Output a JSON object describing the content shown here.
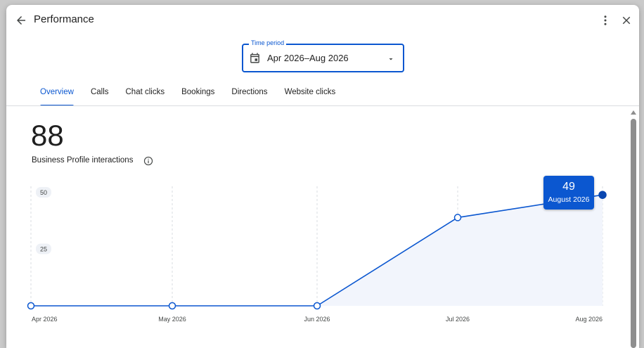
{
  "header": {
    "title": "Performance"
  },
  "time_period": {
    "label": "Time period",
    "value": "Apr 2026–Aug 2026"
  },
  "tabs": [
    {
      "label": "Overview",
      "active": true
    },
    {
      "label": "Calls",
      "active": false
    },
    {
      "label": "Chat clicks",
      "active": false
    },
    {
      "label": "Bookings",
      "active": false
    },
    {
      "label": "Directions",
      "active": false
    },
    {
      "label": "Website clicks",
      "active": false
    }
  ],
  "metric": {
    "value": "88",
    "label": "Business Profile interactions"
  },
  "tooltip": {
    "value": "49",
    "date": "August 2026"
  },
  "colors": {
    "accent": "#0b57d0",
    "area_fill": "#f2f5fc",
    "grid": "#dadce0"
  },
  "icons": {
    "back": "arrow-left-icon",
    "more": "more-vert-icon",
    "close": "close-icon",
    "calendar": "calendar-icon",
    "caret": "caret-down-icon",
    "info": "info-icon"
  },
  "chart_data": {
    "type": "area",
    "categories": [
      "Apr 2026",
      "May 2026",
      "Jun 2026",
      "Jul 2026",
      "Aug 2026"
    ],
    "values": [
      0,
      0,
      0,
      39,
      49
    ],
    "yticks": [
      25,
      50
    ],
    "ylim": [
      0,
      50
    ],
    "selected_index": 4,
    "grid": "vertical-dashed"
  }
}
